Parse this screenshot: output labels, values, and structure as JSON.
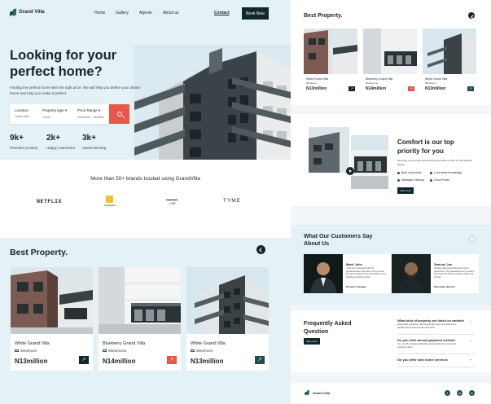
{
  "brand_name": "Grand Villa",
  "nav": {
    "items": [
      "Home",
      "Gallery",
      "Agents",
      "About us"
    ],
    "contact": "Contact",
    "book_now": "Book Now"
  },
  "hero": {
    "title": "Looking for your perfect home?",
    "description": "Finding the perfect home with the right price. We will help you define your dream home and help you make it perfect.",
    "search": {
      "location_label": "Location",
      "location_value": "Lagos state",
      "type_label": "Property type",
      "type_value": "House",
      "price_label": "Price Range",
      "price_value": "N12million - 18million"
    },
    "stats": [
      {
        "value": "9k+",
        "label": "Premium product"
      },
      {
        "value": "2k+",
        "label": "Happy customers"
      },
      {
        "value": "3k+",
        "label": "Award winning"
      }
    ]
  },
  "brands": {
    "title": "More than 50+ brands trusted using GrandVilla",
    "items": [
      "NETFLIX",
      "Fipsdigital",
      "LKE",
      "TYME"
    ]
  },
  "best_property": {
    "title": "Best Property.",
    "cards": [
      {
        "name": "White Grand Villa",
        "beds": "5bedroom",
        "price": "N13million",
        "accent": "#12282c"
      },
      {
        "name": "Blueberry Grand Villa",
        "beds": "5bedrooms",
        "price": "N14million",
        "accent": "#e8564a"
      },
      {
        "name": "White Grand Villa",
        "beds": "5bedroom",
        "price": "N13million",
        "accent": "#1f4f55"
      }
    ]
  },
  "comfort": {
    "title": "Comfort is our top priority for you",
    "description": "We bring you the best and amazing purchase comfort in international places.",
    "features": [
      "Best in services",
      "Local area knowledge",
      "Managed Viewing",
      "Good Prices"
    ],
    "see_more": "See more"
  },
  "testimonials": {
    "title": "What Our Customers Say About Us",
    "items": [
      {
        "name": "Mark John",
        "text": "I was truly impressed with the professionalism and ease of the process. The team helped me find the perfect home quickly and without stress.",
        "role": "Product manager"
      },
      {
        "name": "Samuel Joe",
        "text": "Working with Grand Villa was a great experience. They answered every question and made the whole purchase simple and smooth.",
        "role": "Executive director"
      }
    ]
  },
  "faq": {
    "title": "Frequently Asked Question",
    "see_more": "See more",
    "items": [
      {
        "question": "What kind of property are listed on website",
        "answer": "Apartments, duplexes, villas and family homes are listed on our website across several states and cities.",
        "toggle": "–"
      },
      {
        "question": "Do you offer annual payment method",
        "answer": "Yes, we offer annual and flexible payment plans for most of the properties listed.",
        "toggle": "–"
      },
      {
        "question": "Do you offer loan home services",
        "answer": "",
        "toggle": "+"
      }
    ]
  },
  "footer": {
    "social": [
      "f",
      "◎",
      "in"
    ]
  },
  "colors": {
    "dark": "#12282c",
    "accent": "#e8564a",
    "teal": "#1f4f55",
    "light_bg": "#e4f2f7"
  }
}
